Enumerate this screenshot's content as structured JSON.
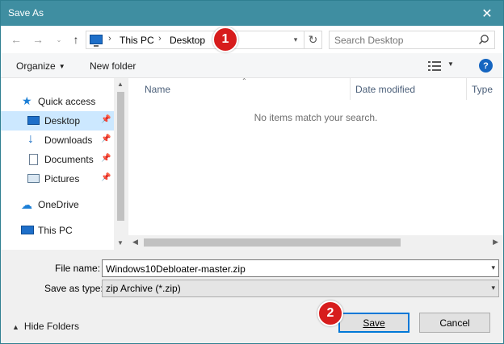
{
  "window": {
    "title": "Save As"
  },
  "address": {
    "segments": [
      "This PC",
      "Desktop"
    ]
  },
  "search": {
    "placeholder": "Search Desktop"
  },
  "toolbar": {
    "organize": "Organize",
    "new_folder": "New folder",
    "help": "?"
  },
  "nav": {
    "quick_access": "Quick access",
    "items": [
      {
        "label": "Desktop",
        "icon": "desktop-icon",
        "pinned": true,
        "selected": true
      },
      {
        "label": "Downloads",
        "icon": "download-arrow-icon",
        "pinned": true
      },
      {
        "label": "Documents",
        "icon": "document-icon",
        "pinned": true
      },
      {
        "label": "Pictures",
        "icon": "picture-icon",
        "pinned": true
      }
    ],
    "onedrive": "OneDrive",
    "this_pc": "This PC"
  },
  "columns": {
    "name": "Name",
    "date_modified": "Date modified",
    "type": "Type"
  },
  "content": {
    "empty_message": "No items match your search."
  },
  "form": {
    "file_name_label": "File name:",
    "file_name_value": "Windows10Debloater-master.zip",
    "save_as_type_label": "Save as type:",
    "save_as_type_value": "zip Archive (*.zip)"
  },
  "footer": {
    "hide_folders": "Hide Folders",
    "save": "Save",
    "cancel": "Cancel"
  },
  "annotations": {
    "badge1": "1",
    "badge2": "2"
  },
  "colors": {
    "titlebar": "#3f8ea1",
    "selection": "#cce8ff",
    "accent": "#0078d7",
    "badge": "#d71c1c"
  }
}
